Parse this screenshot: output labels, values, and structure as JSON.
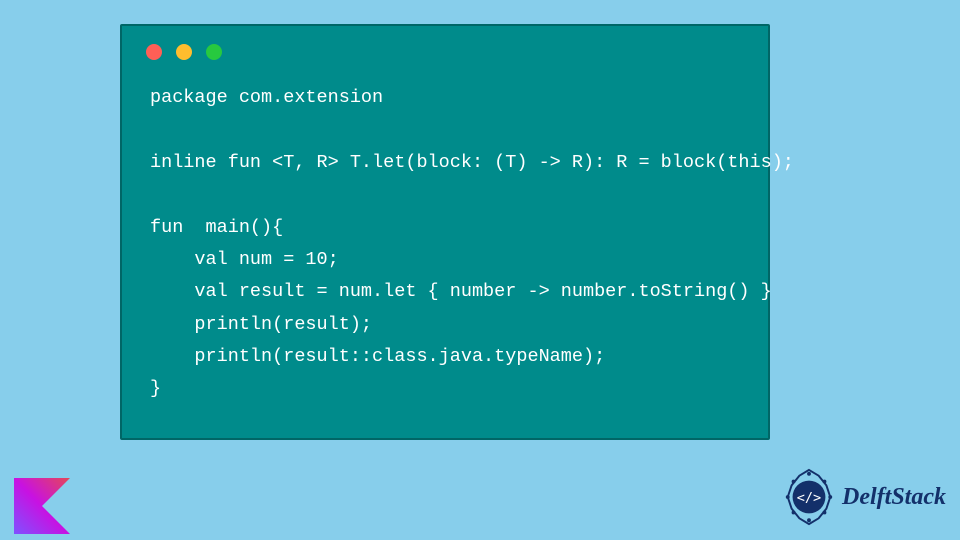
{
  "code_block": {
    "language": "kotlin",
    "window_controls": [
      "close",
      "minimize",
      "zoom"
    ],
    "lines": [
      "package com.extension",
      "",
      "inline fun <T, R> T.let(block: (T) -> R): R = block(this);",
      "",
      "fun  main(){",
      "    val num = 10;",
      "    val result = num.let { number -> number.toString() }",
      "    println(result);",
      "    println(result::class.java.typeName);",
      "}"
    ]
  },
  "branding": {
    "site_name": "DelftStack",
    "language_logo": "kotlin"
  },
  "colors": {
    "page_bg": "#87ceeb",
    "code_bg": "#008b8b",
    "code_text": "#ffffff",
    "brand_text": "#13306a"
  }
}
